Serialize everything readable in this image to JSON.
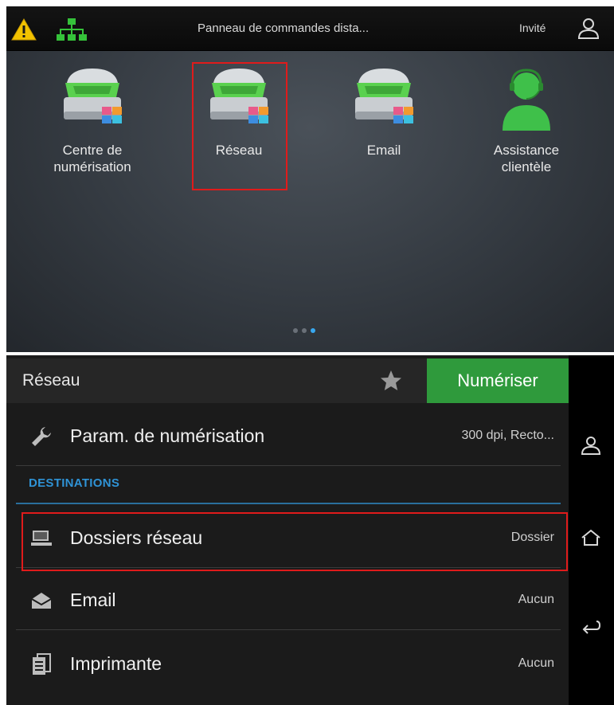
{
  "top_bar": {
    "title": "Panneau de commandes dista...",
    "user_label": "Invité"
  },
  "apps": [
    {
      "label": "Centre de\nnumérisation",
      "icon": "scanner-icon"
    },
    {
      "label": "Réseau",
      "icon": "scanner-icon"
    },
    {
      "label": "Email",
      "icon": "scanner-icon"
    },
    {
      "label": "Assistance\nclientèle",
      "icon": "support-agent-icon"
    }
  ],
  "pager": {
    "pages": 3,
    "current": 3
  },
  "bottom": {
    "header_title": "Réseau",
    "scan_button": "Numériser",
    "scan_settings": {
      "label": "Param. de numérisation",
      "value": "300 dpi, Recto..."
    },
    "section_title": "DESTINATIONS",
    "destinations": [
      {
        "label": "Dossiers réseau",
        "value": "Dossier",
        "icon": "network-folder-icon"
      },
      {
        "label": "Email",
        "value": "Aucun",
        "icon": "email-icon"
      },
      {
        "label": "Imprimante",
        "value": "Aucun",
        "icon": "printer-icon"
      }
    ]
  },
  "colors": {
    "accent_green": "#2f9a3c",
    "section_blue": "#2f93d6",
    "highlight_red": "#e01b1b",
    "warning_yellow": "#f2c200",
    "network_green": "#35c23a"
  }
}
